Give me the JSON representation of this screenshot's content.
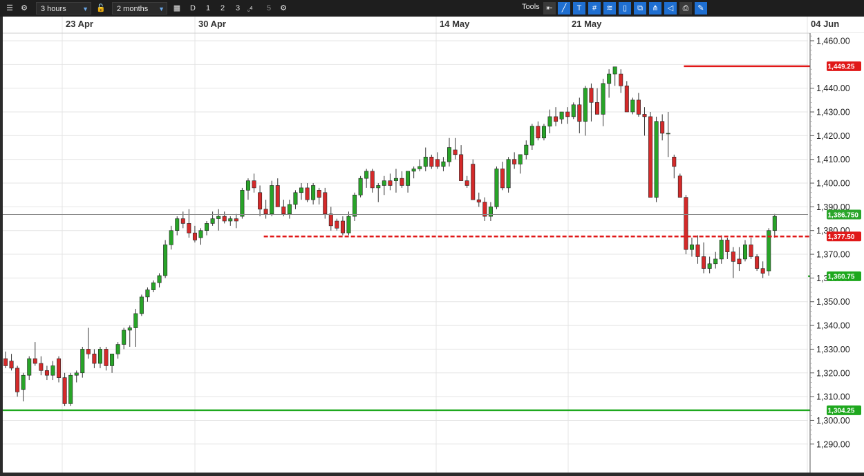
{
  "toolbar": {
    "interval": "3 hours",
    "range": "2 months",
    "buttons": [
      "D",
      "1",
      "2",
      "3",
      "4",
      "5"
    ],
    "tools_label": "Tools"
  },
  "colors": {
    "up": "#28a428",
    "down": "#d42a2a",
    "grid": "#e4e4e4",
    "resistance": "#e01818",
    "support": "#1ea81e"
  },
  "chart_data": {
    "type": "candlestick",
    "x_tick_labels": [
      "23 Apr",
      "30 Apr",
      "14 May",
      "21 May",
      "04 Jun"
    ],
    "y_tick_labels": [
      "1,460.00",
      "1,440.00",
      "1,430.00",
      "1,420.00",
      "1,410.00",
      "1,400.00",
      "1,390.00",
      "1,380.00",
      "1,370.00",
      "1,360.00",
      "1,350.00",
      "1,340.00",
      "1,330.00",
      "1,320.00",
      "1,310.00",
      "1,300.00",
      "1,290.00"
    ],
    "ylim": [
      1287,
      1463
    ],
    "grid": true,
    "current_price": {
      "value": 1386.75,
      "label": "1,386.750"
    },
    "levels": [
      {
        "value": 1449.25,
        "label": "1,449.25",
        "style": "solid",
        "color": "#e01818",
        "start_candle": 115
      },
      {
        "value": 1377.5,
        "label": "1,377.50",
        "style": "dashed",
        "color": "#e01818",
        "start_candle": 44
      },
      {
        "value": 1360.75,
        "label": "1,360.75",
        "style": "solid",
        "color": "#1ea81e",
        "start_candle": 136
      },
      {
        "value": 1304.25,
        "label": "1,304.25",
        "style": "solid",
        "color": "#1ea81e",
        "start_candle": 0
      }
    ],
    "candles": [
      [
        1326,
        1329,
        1322,
        1323
      ],
      [
        1325,
        1328,
        1321,
        1322
      ],
      [
        1322,
        1323,
        1310,
        1312
      ],
      [
        1313,
        1320,
        1308,
        1319
      ],
      [
        1319,
        1327,
        1317,
        1326
      ],
      [
        1326,
        1333,
        1323,
        1324
      ],
      [
        1324,
        1327,
        1319,
        1321
      ],
      [
        1321,
        1323,
        1317,
        1319
      ],
      [
        1319,
        1325,
        1317,
        1323
      ],
      [
        1326,
        1327,
        1316,
        1318
      ],
      [
        1318,
        1320,
        1306,
        1307
      ],
      [
        1307,
        1320,
        1306,
        1319
      ],
      [
        1319,
        1321,
        1316,
        1320
      ],
      [
        1320,
        1331,
        1318,
        1330
      ],
      [
        1330,
        1339,
        1326,
        1328
      ],
      [
        1328,
        1330,
        1322,
        1324
      ],
      [
        1324,
        1331,
        1322,
        1330
      ],
      [
        1330,
        1331,
        1321,
        1323
      ],
      [
        1323,
        1328,
        1320,
        1328
      ],
      [
        1328,
        1333,
        1326,
        1332
      ],
      [
        1332,
        1339,
        1330,
        1338
      ],
      [
        1338,
        1340,
        1331,
        1339
      ],
      [
        1339,
        1347,
        1331,
        1345
      ],
      [
        1345,
        1353,
        1344,
        1352
      ],
      [
        1352,
        1356,
        1350,
        1355
      ],
      [
        1355,
        1359,
        1354,
        1358
      ],
      [
        1358,
        1362,
        1356,
        1361
      ],
      [
        1361,
        1376,
        1360,
        1374
      ],
      [
        1374,
        1382,
        1372,
        1380
      ],
      [
        1380,
        1386,
        1378,
        1385
      ],
      [
        1385,
        1388,
        1381,
        1383
      ],
      [
        1383,
        1389,
        1377,
        1379
      ],
      [
        1379,
        1382,
        1375,
        1376
      ],
      [
        1377,
        1381,
        1374,
        1380
      ],
      [
        1380,
        1384,
        1378,
        1383
      ],
      [
        1383,
        1388,
        1382,
        1385
      ],
      [
        1385,
        1389,
        1380,
        1386
      ],
      [
        1386,
        1388,
        1383,
        1384
      ],
      [
        1384,
        1386,
        1382,
        1385
      ],
      [
        1385,
        1387,
        1381,
        1384
      ],
      [
        1386,
        1398,
        1385,
        1397
      ],
      [
        1397,
        1402,
        1393,
        1401
      ],
      [
        1401,
        1404,
        1396,
        1398
      ],
      [
        1396,
        1399,
        1386,
        1389
      ],
      [
        1389,
        1393,
        1385,
        1387
      ],
      [
        1387,
        1401,
        1386,
        1399
      ],
      [
        1399,
        1402,
        1390,
        1390
      ],
      [
        1390,
        1393,
        1386,
        1387
      ],
      [
        1387,
        1393,
        1385,
        1391
      ],
      [
        1391,
        1397,
        1389,
        1396
      ],
      [
        1396,
        1400,
        1393,
        1398
      ],
      [
        1398,
        1400,
        1392,
        1393
      ],
      [
        1393,
        1400,
        1391,
        1399
      ],
      [
        1397,
        1398,
        1391,
        1394
      ],
      [
        1396,
        1398,
        1385,
        1387
      ],
      [
        1387,
        1390,
        1380,
        1382
      ],
      [
        1384,
        1385,
        1380,
        1381
      ],
      [
        1384,
        1386,
        1378,
        1379
      ],
      [
        1379,
        1388,
        1378,
        1386
      ],
      [
        1386,
        1396,
        1384,
        1395
      ],
      [
        1395,
        1403,
        1394,
        1402
      ],
      [
        1402,
        1406,
        1398,
        1405
      ],
      [
        1405,
        1406,
        1396,
        1398
      ],
      [
        1398,
        1400,
        1392,
        1399
      ],
      [
        1399,
        1403,
        1395,
        1401
      ],
      [
        1401,
        1404,
        1397,
        1399
      ],
      [
        1401,
        1406,
        1396,
        1402
      ],
      [
        1402,
        1405,
        1398,
        1399
      ],
      [
        1399,
        1404,
        1396,
        1405
      ],
      [
        1405,
        1407,
        1402,
        1406
      ],
      [
        1406,
        1410,
        1405,
        1407
      ],
      [
        1407,
        1415,
        1405,
        1411
      ],
      [
        1411,
        1412,
        1406,
        1407
      ],
      [
        1410,
        1413,
        1406,
        1407
      ],
      [
        1407,
        1411,
        1405,
        1409
      ],
      [
        1409,
        1419,
        1407,
        1415
      ],
      [
        1414,
        1419,
        1410,
        1412
      ],
      [
        1412,
        1416,
        1401,
        1401
      ],
      [
        1401,
        1403,
        1398,
        1399
      ],
      [
        1408,
        1410,
        1393,
        1393
      ],
      [
        1393,
        1396,
        1390,
        1392
      ],
      [
        1392,
        1394,
        1384,
        1386
      ],
      [
        1386,
        1392,
        1384,
        1390
      ],
      [
        1390,
        1407,
        1389,
        1406
      ],
      [
        1406,
        1409,
        1397,
        1398
      ],
      [
        1398,
        1411,
        1396,
        1410
      ],
      [
        1410,
        1413,
        1406,
        1408
      ],
      [
        1408,
        1412,
        1404,
        1412
      ],
      [
        1412,
        1418,
        1410,
        1416
      ],
      [
        1416,
        1425,
        1414,
        1424
      ],
      [
        1424,
        1426,
        1418,
        1419
      ],
      [
        1419,
        1425,
        1418,
        1424
      ],
      [
        1424,
        1431,
        1421,
        1428
      ],
      [
        1428,
        1432,
        1424,
        1426
      ],
      [
        1427,
        1430,
        1425,
        1430
      ],
      [
        1430,
        1432,
        1425,
        1428
      ],
      [
        1428,
        1434,
        1427,
        1433
      ],
      [
        1433,
        1436,
        1421,
        1426
      ],
      [
        1426,
        1441,
        1420,
        1440
      ],
      [
        1440,
        1442,
        1426,
        1434
      ],
      [
        1434,
        1440,
        1433,
        1429
      ],
      [
        1429,
        1444,
        1424,
        1442
      ],
      [
        1442,
        1448,
        1436,
        1446
      ],
      [
        1446,
        1448,
        1441,
        1449
      ],
      [
        1446,
        1448,
        1438,
        1441
      ],
      [
        1441,
        1443,
        1430,
        1430
      ],
      [
        1430,
        1436,
        1429,
        1435
      ],
      [
        1435,
        1438,
        1428,
        1429
      ],
      [
        1429,
        1432,
        1420,
        1428
      ],
      [
        1428,
        1430,
        1394,
        1394
      ],
      [
        1394,
        1428,
        1392,
        1426
      ],
      [
        1426,
        1429,
        1418,
        1421
      ],
      [
        1421,
        1430,
        1411,
        1421
      ],
      [
        1411,
        1412,
        1402,
        1407
      ],
      [
        1403,
        1404,
        1394,
        1394
      ],
      [
        1394,
        1395,
        1370,
        1372
      ],
      [
        1372,
        1377,
        1369,
        1374
      ],
      [
        1374,
        1378,
        1366,
        1369
      ],
      [
        1369,
        1375,
        1362,
        1364
      ],
      [
        1364,
        1369,
        1362,
        1366
      ],
      [
        1366,
        1371,
        1364,
        1368
      ],
      [
        1368,
        1378,
        1366,
        1376
      ],
      [
        1376,
        1377,
        1368,
        1371
      ],
      [
        1371,
        1373,
        1360,
        1367
      ],
      [
        1368,
        1373,
        1363,
        1366
      ],
      [
        1368,
        1376,
        1367,
        1374
      ],
      [
        1374,
        1377,
        1368,
        1369
      ],
      [
        1369,
        1370,
        1363,
        1364
      ],
      [
        1364,
        1367,
        1360,
        1362
      ],
      [
        1363,
        1381,
        1361,
        1380
      ],
      [
        1380,
        1387,
        1377,
        1386
      ]
    ]
  }
}
